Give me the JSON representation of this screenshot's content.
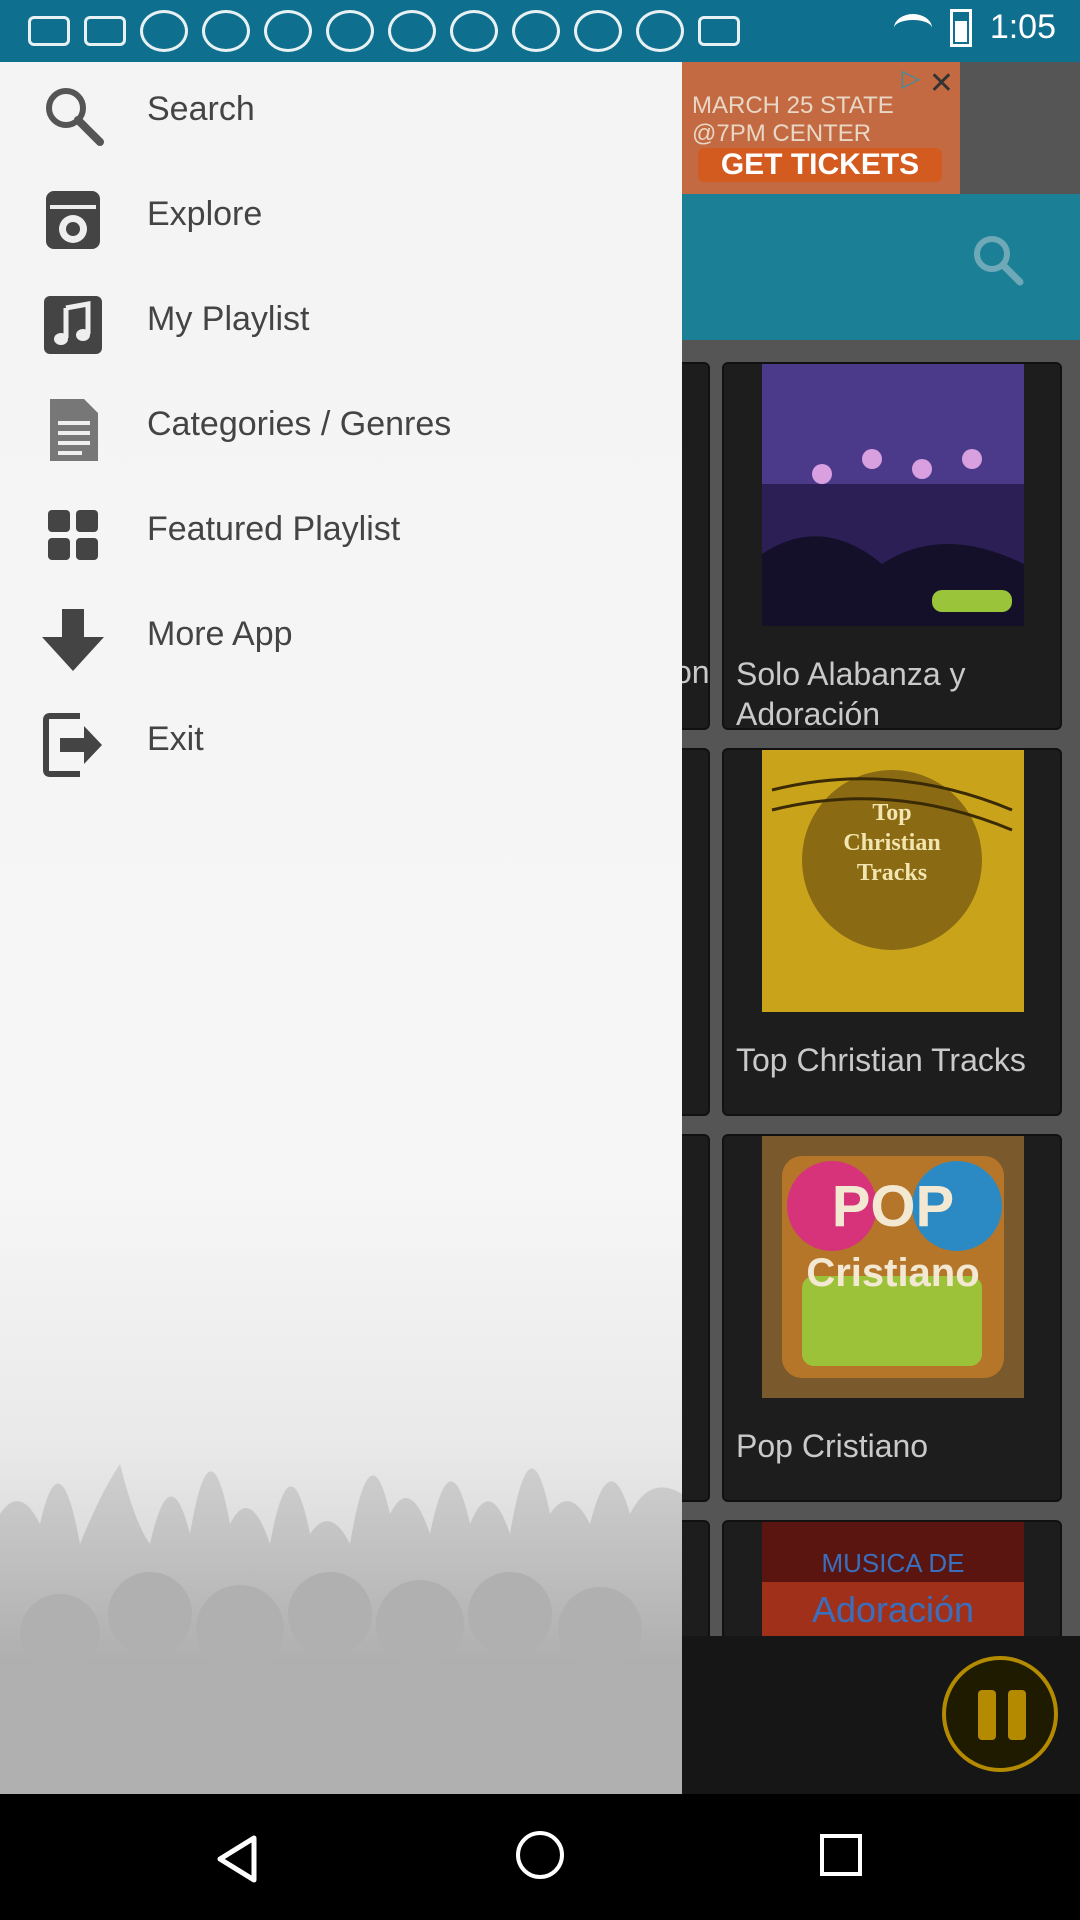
{
  "status_bar": {
    "time": "1:05",
    "notification_count": 11
  },
  "ad": {
    "line1": "MARCH 25  STATE  @7PM   CENTER",
    "cta": "GET TICKETS"
  },
  "drawer": {
    "items": [
      {
        "label": "Search",
        "icon": "search-icon"
      },
      {
        "label": "Explore",
        "icon": "explore-icon"
      },
      {
        "label": "My Playlist",
        "icon": "music-note-icon"
      },
      {
        "label": "Categories / Genres",
        "icon": "document-icon"
      },
      {
        "label": "Featured Playlist",
        "icon": "grid-icon"
      },
      {
        "label": "More App",
        "icon": "download-arrow-icon"
      },
      {
        "label": "Exit",
        "icon": "exit-icon"
      }
    ]
  },
  "playlists": [
    {
      "title": "Solo Alabanza y Adoración",
      "left_partial": "on"
    },
    {
      "title": "Top Christian Tracks"
    },
    {
      "title": "Pop Cristiano"
    },
    {
      "title": ""
    }
  ],
  "colors": {
    "status_bar": "#0f6f8e",
    "toolbar": "#1b7f96",
    "drawer_bg": "#f4f4f4",
    "pause_accent": "#b38a00"
  }
}
